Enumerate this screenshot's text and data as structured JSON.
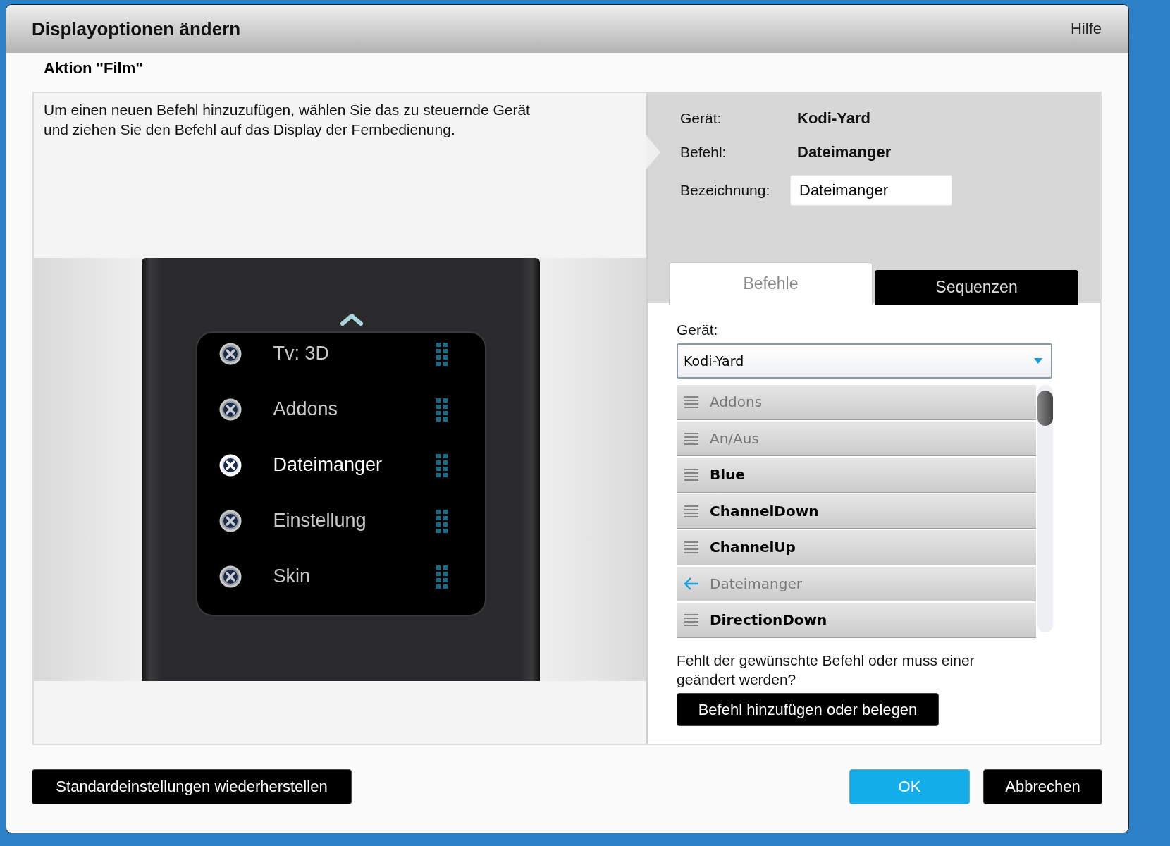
{
  "dialog": {
    "title": "Displayoptionen ändern",
    "help": "Hilfe",
    "subtitle": "Aktion \"Film\""
  },
  "instructions": "Um einen neuen Befehl hinzuzufügen, wählen Sie das zu steuernde Gerät und ziehen Sie den Befehl auf das Display der Fernbedienung.",
  "remote_display": [
    {
      "label": "Tv: 3D",
      "selected": false
    },
    {
      "label": "Addons",
      "selected": false
    },
    {
      "label": "Dateimanger",
      "selected": true
    },
    {
      "label": "Einstellung",
      "selected": false
    },
    {
      "label": "Skin",
      "selected": false
    }
  ],
  "details": {
    "device_label": "Gerät:",
    "device": "Kodi-Yard",
    "command_label": "Befehl:",
    "command": "Dateimanger",
    "name_label": "Bezeichnung:",
    "name_value": "Dateimanger"
  },
  "tabs": [
    {
      "label": "Befehle",
      "selected": true
    },
    {
      "label": "Sequenzen",
      "selected": false
    }
  ],
  "device_select": {
    "label": "Gerät:",
    "value": "Kodi-Yard"
  },
  "commands": [
    {
      "label": "Addons",
      "kind": "command",
      "assigned": true
    },
    {
      "label": "An/Aus",
      "kind": "command",
      "assigned": true
    },
    {
      "label": "Blue",
      "kind": "command",
      "assigned": false
    },
    {
      "label": "ChannelDown",
      "kind": "command",
      "assigned": false
    },
    {
      "label": "ChannelUp",
      "kind": "command",
      "assigned": false
    },
    {
      "label": "Dateimanger",
      "kind": "current",
      "assigned": true
    },
    {
      "label": "DirectionDown",
      "kind": "command",
      "assigned": false
    }
  ],
  "missing_hint": "Fehlt der gewünschte Befehl oder muss einer geändert werden?",
  "add_button": "Befehl hinzufügen oder belegen",
  "buttons": {
    "reset": "Standardeinstellungen wiederherstellen",
    "ok": "OK",
    "cancel": "Abbrechen"
  }
}
